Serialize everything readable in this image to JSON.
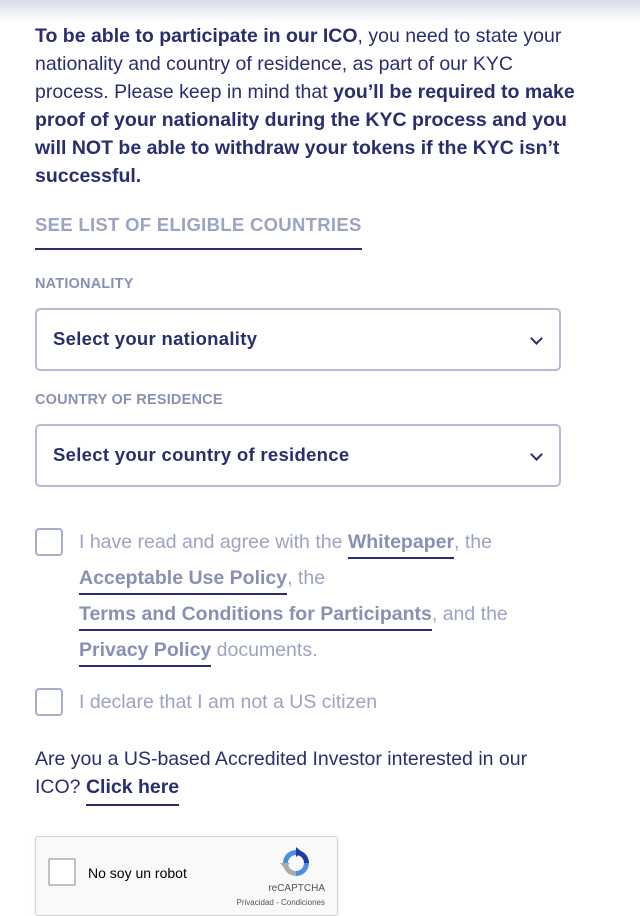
{
  "intro": {
    "part1_bold": "To be able to participate in our ICO",
    "part2": ", you need to state your nationality and country of residence, as part of our KYC process. Please keep in mind that ",
    "part3_bold": "you’ll be required to make proof of your nationality during the KYC process and you will NOT be able to withdraw your tokens if the KYC isn’t successful."
  },
  "eligible_countries_link": "SEE LIST OF ELIGIBLE COUNTRIES",
  "nationality": {
    "label": "NATIONALITY",
    "value": "Select your nationality"
  },
  "residence": {
    "label": "COUNTRY OF RESIDENCE",
    "value": "Select your country of residence"
  },
  "agreement": {
    "text1": "I have read and agree with the ",
    "link_whitepaper": "Whitepaper",
    "text2": ", the ",
    "link_aup": "Acceptable Use Policy",
    "text3": ", the ",
    "link_terms": "Terms and Conditions for Participants",
    "text4": ", and the ",
    "link_privacy": "Privacy Policy",
    "text5": " documents."
  },
  "us_declaration": "I declare that I am not a US citizen",
  "accredited": {
    "question": "Are you a US-based Accredited Investor interested in our ICO? ",
    "link": "Click here"
  },
  "recaptcha": {
    "label": "No soy un robot",
    "brand": "reCAPTCHA",
    "privacy": "Privacidad",
    "separator": " - ",
    "terms": "Condiciones"
  },
  "colors": {
    "primary_navy": "#2a2d6e",
    "muted_text": "#9da3c3",
    "border": "#b7bbd5"
  }
}
